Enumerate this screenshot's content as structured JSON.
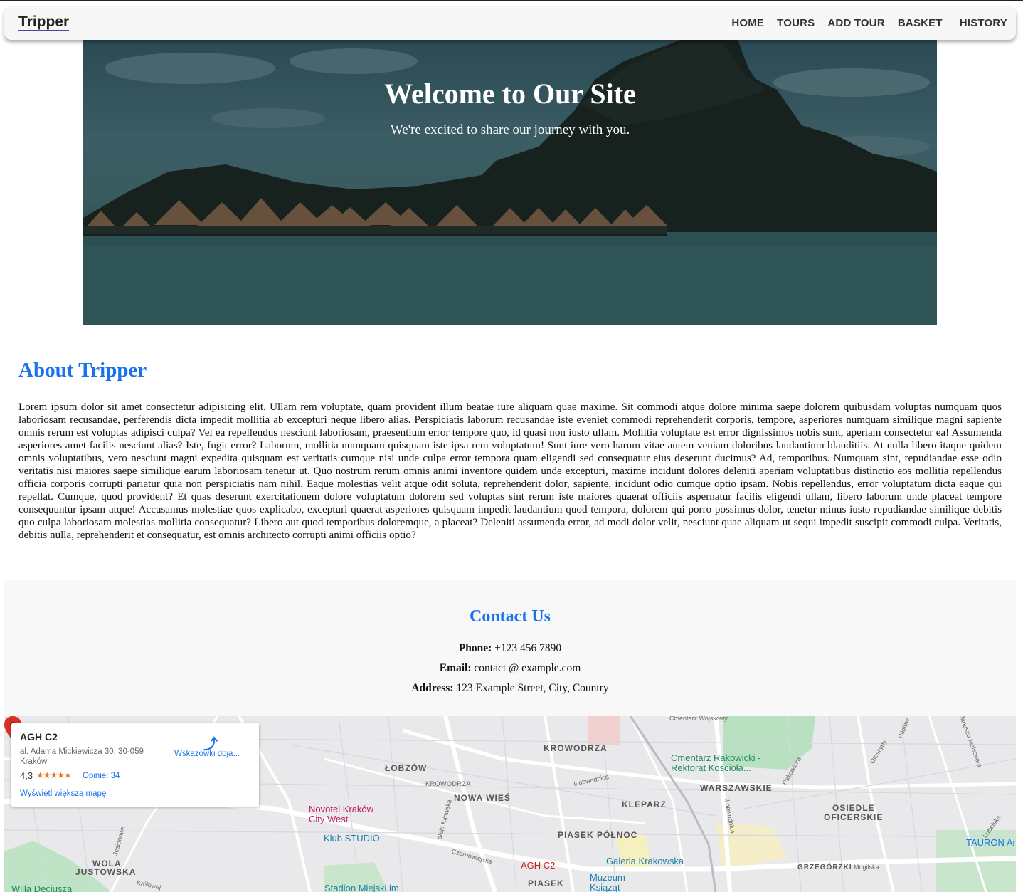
{
  "navbar": {
    "brand": "Tripper",
    "links": [
      "HOME",
      "TOURS",
      "ADD TOUR",
      "BASKET",
      "HISTORY"
    ]
  },
  "hero": {
    "title": "Welcome to Our Site",
    "subtitle": "We're excited to share our journey with you."
  },
  "about": {
    "title": "About Tripper",
    "text": "Lorem ipsum dolor sit amet consectetur adipisicing elit. Ullam rem voluptate, quam provident illum beatae iure aliquam quae maxime. Sit commodi atque dolore minima saepe dolorem quibusdam voluptas numquam quos laboriosam recusandae, perferendis dicta impedit mollitia ab excepturi neque libero alias. Perspiciatis laborum recusandae iste eveniet commodi reprehenderit corporis, tempore, asperiores numquam similique magni sapiente omnis rerum est voluptas adipisci culpa? Vel ea repellendus nesciunt laboriosam, praesentium error tempore quo, id quasi non iusto ullam. Mollitia voluptate est error dignissimos nobis sunt, aperiam consectetur ea! Assumenda asperiores amet facilis nesciunt alias? Iste, fugit error? Laborum, mollitia numquam quisquam iste ipsa rem voluptatum! Sunt iure vero harum vitae autem veniam doloribus laudantium blanditiis. At nulla libero itaque quidem omnis voluptatibus, vero nesciunt magni expedita quisquam est veritatis cumque nisi unde culpa error tempora quam eligendi sed consequatur eius deserunt ducimus? Ad, temporibus. Numquam sint, repudiandae esse odio veritatis nisi maiores saepe similique earum laboriosam tenetur ut. Quo nostrum rerum omnis animi inventore quidem unde excepturi, maxime incidunt dolores deleniti aperiam voluptatibus distinctio eos mollitia repellendus officia corporis corrupti pariatur quia non perspiciatis nam nihil. Eaque molestias velit atque odit soluta, reprehenderit dolor, sapiente, incidunt odio cumque optio ipsam. Nobis repellendus, error voluptatum dicta eaque qui repellat. Cumque, quod provident? Et quas deserunt exercitationem dolore voluptatum dolorem sed voluptas sint rerum iste maiores quaerat officiis aspernatur facilis eligendi ullam, libero laborum unde placeat tempore consequuntur ipsam atque! Accusamus molestiae quos explicabo, excepturi quaerat asperiores quisquam impedit laudantium quod tempora, dolorem qui porro possimus dolor, tenetur minus iusto repudiandae similique debitis quo culpa laboriosam molestias mollitia consequatur? Libero aut quod temporibus doloremque, a placeat? Deleniti assumenda error, ad modi dolor velit, nesciunt quae aliquam ut sequi impedit suscipit commodi culpa. Veritatis, debitis nulla, reprehenderit et consequatur, est omnis architecto corrupti animi officiis optio?"
  },
  "contact": {
    "title": "Contact Us",
    "phone_label": "Phone:",
    "phone": "+123 456 7890",
    "email_label": "Email:",
    "email": "contact @ example.com",
    "address_label": "Address:",
    "address": "123 Example Street, City, Country"
  },
  "map": {
    "card": {
      "title": "AGH C2",
      "address": "al. Adama Mickiewicza 30, 30-059 Kraków",
      "rating": "4,3",
      "stars": "★★★★★",
      "reviews": "Opinie: 34",
      "larger_map": "Wyświetl większą mapę",
      "directions": "Wskazówki doja..."
    },
    "districts": [
      "KROWODRZA",
      "ŁOBZÓW",
      "NOWA WIEŚ",
      "WARSZAWSKIE",
      "KLEPARZ",
      "OSIEDLE",
      "OFICERSKIE",
      "PIASEK PÓŁNOC",
      "WOLA",
      "JUSTOWSKA",
      "PIASEK",
      "GRZEGÓRZKI"
    ],
    "streets": [
      "Cmentarz Wojskowy",
      "KROWODRZA",
      "Il obwodnica",
      "Rakowicka",
      "Jesionowa",
      "aleja Kijowska",
      "Czarnowiejska",
      "Oleszyny",
      "Pilotów",
      "Mogilska",
      "Królowej",
      "Lubelska",
      "Januszu Meissnera",
      "Il obwodnica"
    ],
    "pois": {
      "cemetery": "Cmentarz Rakowicki - Rektorat Kościoła...",
      "novotel": "Novotel Kraków City West",
      "klub": "Klub STUDIO",
      "galeria": "Galeria Krakowska",
      "muzeum": "Muzeum Książąt Czartoryskich",
      "stadion": "Stadion Miejski im",
      "agh": "AGH C2",
      "tauron": "TAURON Ar",
      "willa": "Willa Decjusza"
    }
  },
  "colors": {
    "accent": "#1a73e8",
    "nav_bg": "#f7f7f7",
    "contact_bg": "#f8f8f8"
  }
}
